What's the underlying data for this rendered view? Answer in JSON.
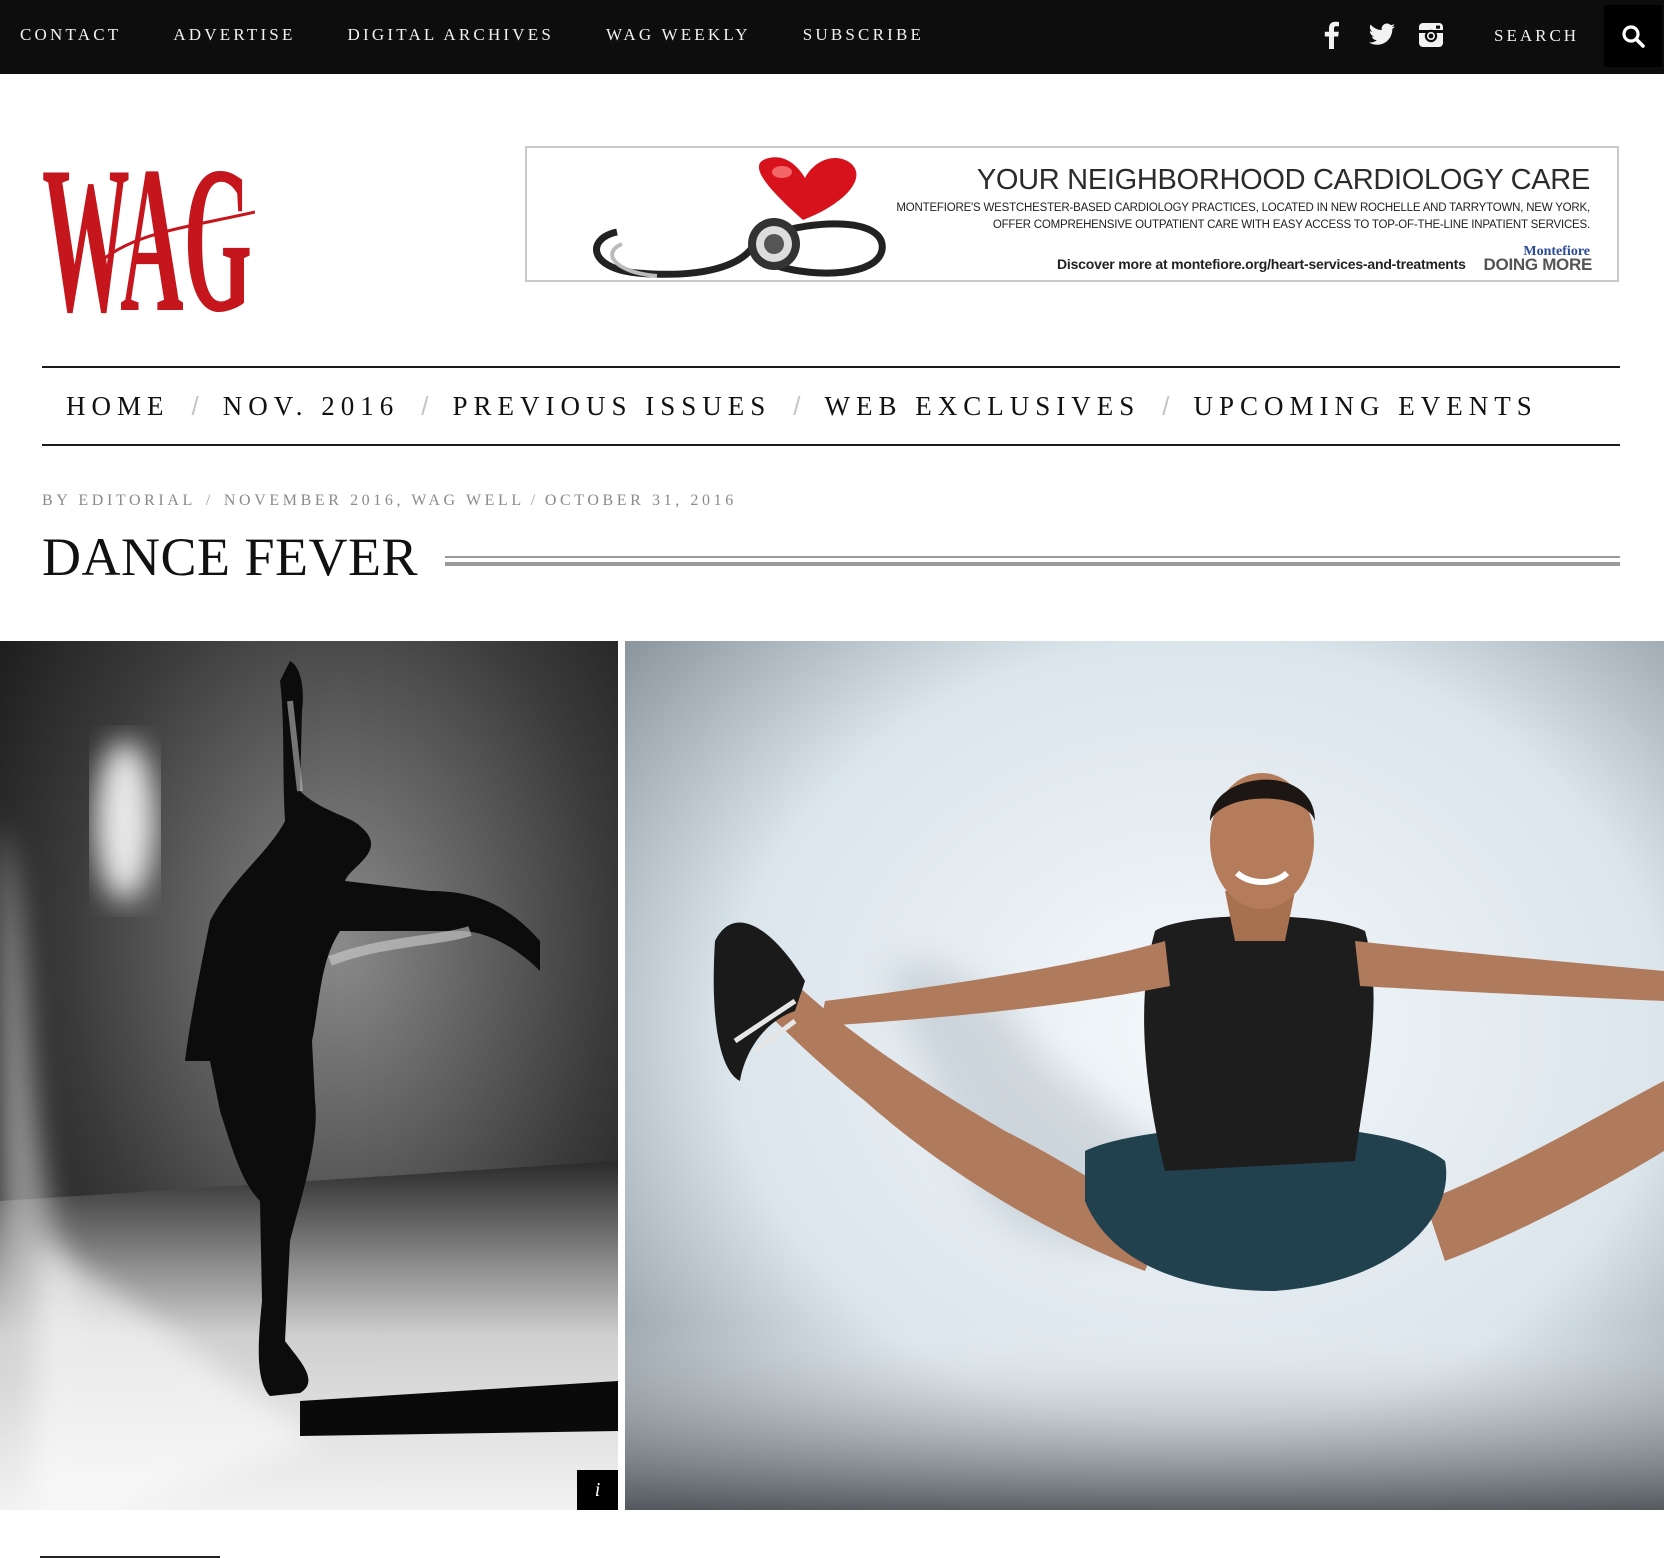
{
  "topbar": {
    "links": [
      "CONTACT",
      "ADVERTISE",
      "DIGITAL ARCHIVES",
      "WAG WEEKLY",
      "SUBSCRIBE"
    ],
    "social_icons": [
      "facebook-icon",
      "twitter-icon",
      "instagram-icon"
    ],
    "search_label": "SEARCH",
    "search_icon": "search-icon"
  },
  "logo": {
    "text": "WAG",
    "color": "#c4161c"
  },
  "ad": {
    "headline": "YOUR NEIGHBORHOOD CARDIOLOGY CARE",
    "body_line1": "MONTEFIORE'S WESTCHESTER-BASED CARDIOLOGY PRACTICES, LOCATED IN NEW ROCHELLE AND TARRYTOWN, NEW YORK,",
    "body_line2": "OFFER COMPREHENSIVE OUTPATIENT CARE WITH EASY ACCESS TO TOP-OF-THE-LINE INPATIENT SERVICES.",
    "cta": "Discover more at montefiore.org/heart-services-and-treatments",
    "brand": "Montefiore",
    "tagline": "DOING MORE"
  },
  "mainnav": {
    "items": [
      "HOME",
      "NOV. 2016",
      "PREVIOUS ISSUES",
      "WEB EXCLUSIVES",
      "UPCOMING EVENTS"
    ],
    "separator": "/"
  },
  "article": {
    "byline": "BY EDITORIAL",
    "categories": "NOVEMBER 2016, WAG WELL",
    "date": "OCTOBER 31, 2016",
    "separator": "/",
    "title": "DANCE FEVER"
  },
  "gallery": {
    "info_label": "i"
  },
  "colors": {
    "topbar_bg": "#0d0d0d",
    "accent_red": "#c4161c",
    "meta_gray": "#8a8a8a"
  }
}
